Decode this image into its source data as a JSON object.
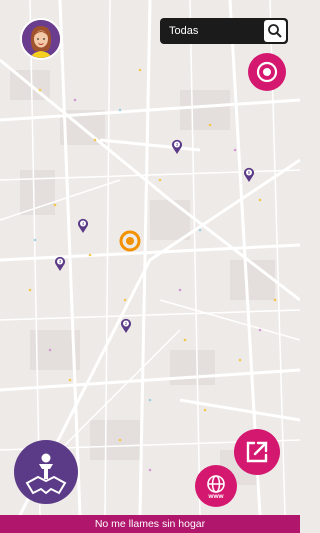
{
  "search": {
    "value": "Todas"
  },
  "footer": {
    "text": "No me llames sin hogar"
  },
  "icons": {
    "avatar": "user-avatar-illustration",
    "search": "search-icon",
    "locate": "target-locate-icon",
    "share": "external-link-icon",
    "web": "www-globe-icon",
    "map_guide": "map-person-icon"
  },
  "markers": [
    {
      "label": "3"
    },
    {
      "label": "6"
    },
    {
      "label": "4"
    },
    {
      "label": "3"
    },
    {
      "label": "2"
    }
  ],
  "colors": {
    "brand": "#b0176c",
    "purple": "#5b3a87",
    "pink_button": "#d4176f",
    "user_location": "#f39200"
  }
}
